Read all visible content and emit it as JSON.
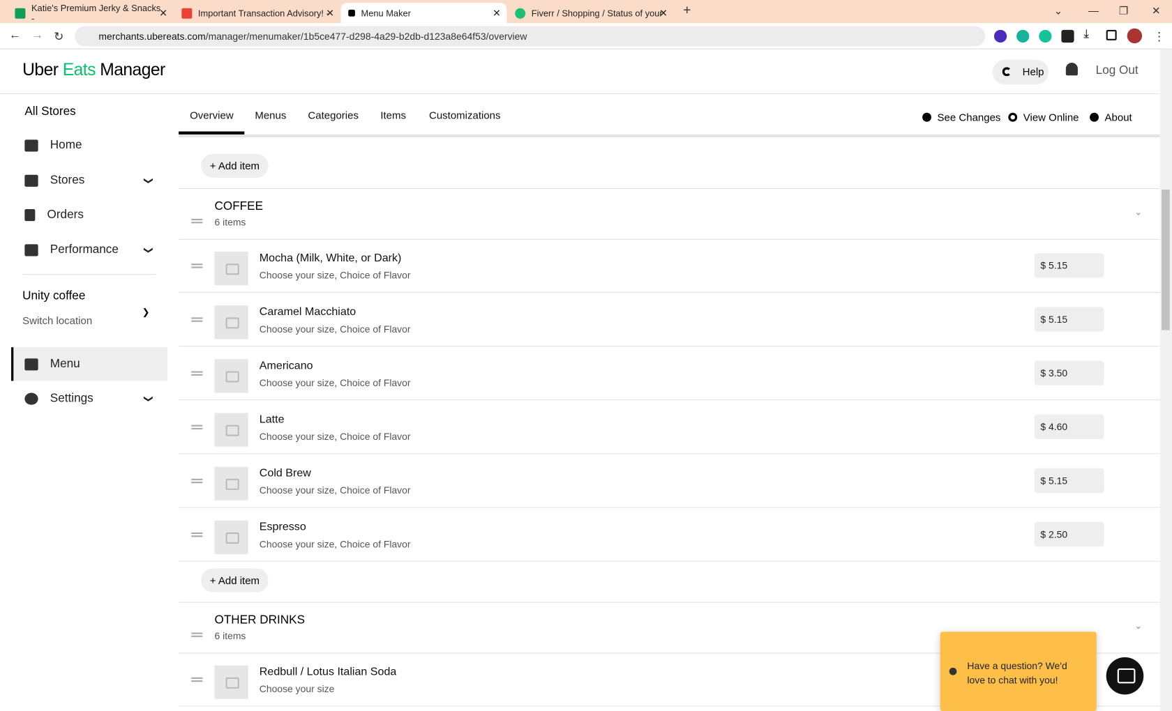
{
  "browser": {
    "tabs": [
      {
        "title": "Katie's Premium Jerky & Snacks -"
      },
      {
        "title": "Important Transaction Advisory! -"
      },
      {
        "title": "Menu Maker"
      },
      {
        "title": "Fiverr / Shopping / Status of your"
      }
    ],
    "url_domain": "merchants.ubereats.com",
    "url_path": "/manager/menumaker/1b5ce477-d298-4a29-b2db-d123a8e64f53/overview"
  },
  "header": {
    "logo_a": "Uber ",
    "logo_b": "Eats",
    "logo_c": " Manager",
    "help": "Help",
    "logout": "Log Out"
  },
  "sidebar": {
    "all_stores": "All Stores",
    "items": [
      {
        "label": "Home"
      },
      {
        "label": "Stores"
      },
      {
        "label": "Orders"
      },
      {
        "label": "Performance"
      }
    ],
    "store_name": "Unity coffee",
    "switch": "Switch location",
    "menu": "Menu",
    "settings": "Settings"
  },
  "tabs": [
    {
      "label": "Overview"
    },
    {
      "label": "Menus"
    },
    {
      "label": "Categories"
    },
    {
      "label": "Items"
    },
    {
      "label": "Customizations"
    }
  ],
  "actions": {
    "see_changes": "See Changes",
    "view_online": "View Online",
    "about": "About"
  },
  "add_item": "+ Add item",
  "categories": [
    {
      "name": "COFFEE",
      "count": "6 items",
      "items": [
        {
          "name": "Mocha (Milk, White, or Dark)",
          "desc": "Choose your size, Choice of Flavor",
          "price": "$  5.15"
        },
        {
          "name": "Caramel Macchiato",
          "desc": "Choose your size, Choice of Flavor",
          "price": "$  5.15"
        },
        {
          "name": "Americano",
          "desc": "Choose your size, Choice of Flavor",
          "price": "$  3.50"
        },
        {
          "name": "Latte",
          "desc": "Choose your size, Choice of Flavor",
          "price": "$  4.60"
        },
        {
          "name": "Cold Brew",
          "desc": "Choose your size, Choice of Flavor",
          "price": "$  5.15"
        },
        {
          "name": "Espresso",
          "desc": "Choose your size, Choice of Flavor",
          "price": "$  2.50"
        }
      ]
    },
    {
      "name": "OTHER DRINKS",
      "count": "6 items",
      "items": [
        {
          "name": "Redbull / Lotus Italian Soda",
          "desc": "Choose your size"
        }
      ]
    }
  ],
  "chat": {
    "text": "Have a question? We'd love to chat with you!"
  }
}
